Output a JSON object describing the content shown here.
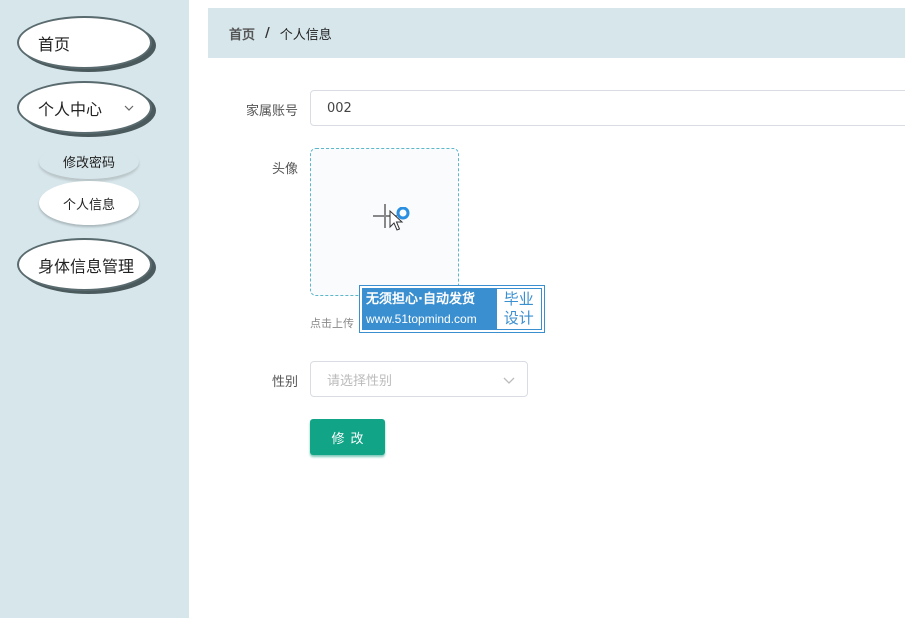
{
  "sidebar": {
    "items": [
      {
        "label": "首页"
      },
      {
        "label": "个人中心"
      },
      {
        "label": "身体信息管理"
      }
    ],
    "sub_items": [
      {
        "label": "修改密码"
      },
      {
        "label": "个人信息"
      }
    ]
  },
  "breadcrumb": {
    "home": "首页",
    "separator": "/",
    "current": "个人信息"
  },
  "form": {
    "account_label": "家属账号",
    "account_value": "002",
    "avatar_label": "头像",
    "upload_hint": "点击上传",
    "gender_label": "性别",
    "gender_placeholder": "请选择性别",
    "submit_label": "修改"
  },
  "watermark": {
    "line1": "无须担心·自动发货",
    "line2": "www.51topmind.com",
    "badge_line1": "毕业",
    "badge_line2": "设计"
  },
  "colors": {
    "sidebar_bg": "#d7e6eb",
    "accent": "#12a487",
    "upload_border": "#5bb7c9",
    "watermark_blue": "#3a8fd0"
  }
}
